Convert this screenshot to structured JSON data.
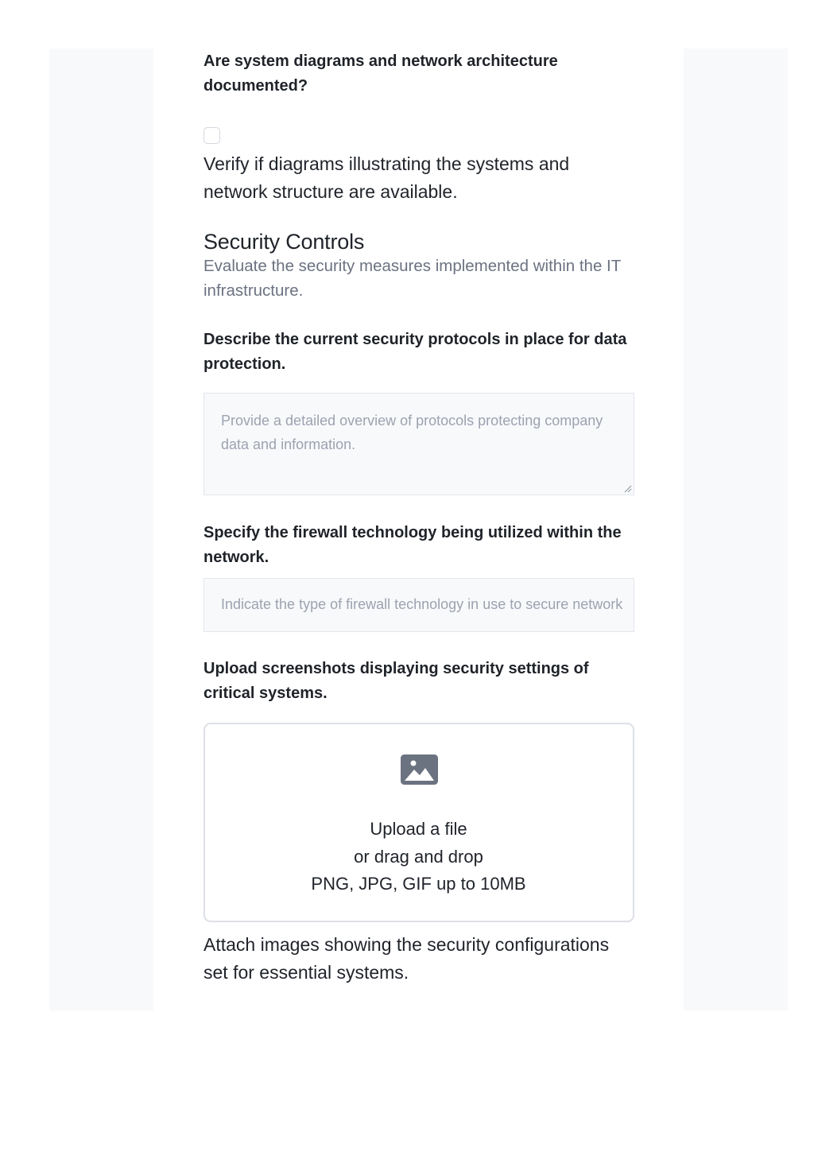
{
  "q1": {
    "label": "Are system diagrams and network architecture documented?",
    "help": "Verify if diagrams illustrating the systems and network structure are available."
  },
  "section": {
    "title": "Security Controls",
    "description": "Evaluate the security measures implemented within the IT infrastructure."
  },
  "q2": {
    "label": "Describe the current security protocols in place for data protection.",
    "placeholder": "Provide a detailed overview of protocols protecting company data and information."
  },
  "q3": {
    "label": "Specify the firewall technology being utilized within the network.",
    "placeholder": "Indicate the type of firewall technology in use to secure network"
  },
  "q4": {
    "label": "Upload screenshots displaying security settings of critical systems.",
    "upload_link": "Upload a file",
    "upload_alt": "or drag and drop",
    "upload_hint": "PNG, JPG, GIF up to 10MB",
    "help": "Attach images showing the security configurations set for essential systems."
  },
  "icons": {
    "upload": "image-icon",
    "checkbox": "checkbox-unchecked"
  },
  "colors": {
    "side_panel": "#f8f9fb",
    "muted_text": "#6b7280",
    "placeholder": "#9ca3af",
    "border": "#e3e6ea",
    "icon": "#6b7280"
  }
}
